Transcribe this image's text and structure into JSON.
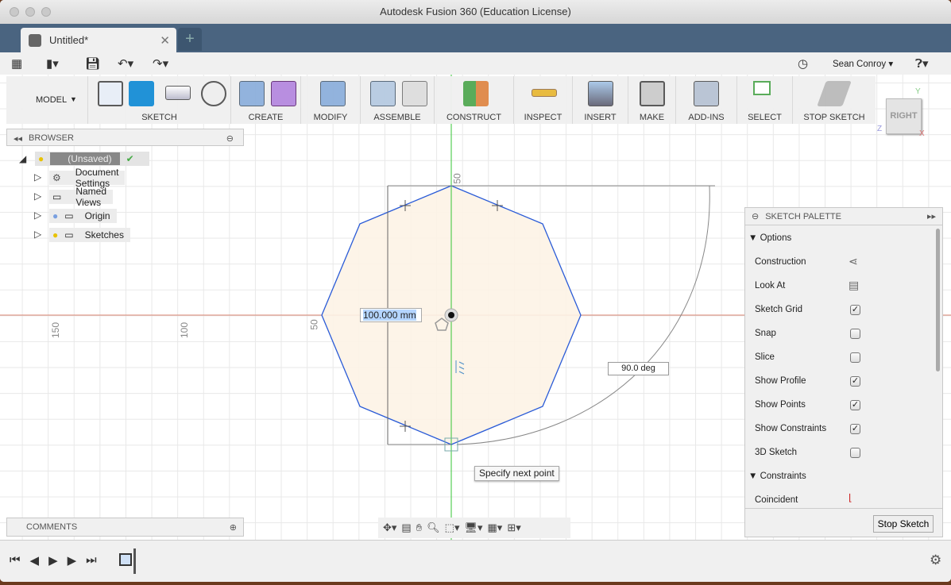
{
  "window": {
    "title": "Autodesk Fusion 360 (Education License)"
  },
  "tabs": [
    {
      "label": "Untitled*",
      "close": "✕"
    },
    {
      "label": "+"
    }
  ],
  "quickbar": {
    "user": "Sean Conroy"
  },
  "toolbar": {
    "workspace": "MODEL",
    "groups": [
      "SKETCH",
      "CREATE",
      "MODIFY",
      "ASSEMBLE",
      "CONSTRUCT",
      "INSPECT",
      "INSERT",
      "MAKE",
      "ADD-INS",
      "SELECT",
      "STOP SKETCH"
    ]
  },
  "viewcube": {
    "face": "RIGHT",
    "axes": {
      "y": "Y",
      "z": "Z",
      "x": "X"
    }
  },
  "browser": {
    "title": "BROWSER",
    "root": "(Unsaved)",
    "items": [
      "Document Settings",
      "Named Views",
      "Origin",
      "Sketches"
    ]
  },
  "comments": {
    "title": "COMMENTS"
  },
  "sketch_palette": {
    "title": "SKETCH PALETTE",
    "sections": {
      "options": "Options",
      "constraints": "Constraints"
    },
    "options": [
      {
        "label": "Construction",
        "type": "icon",
        "icon": "construction-icon"
      },
      {
        "label": "Look At",
        "type": "icon",
        "icon": "look-at-icon"
      },
      {
        "label": "Sketch Grid",
        "checked": true
      },
      {
        "label": "Snap",
        "checked": false
      },
      {
        "label": "Slice",
        "checked": false
      },
      {
        "label": "Show Profile",
        "checked": true
      },
      {
        "label": "Show Points",
        "checked": true
      },
      {
        "label": "Show Constraints",
        "checked": true
      },
      {
        "label": "3D Sketch",
        "checked": false
      }
    ],
    "constraints": [
      {
        "label": "Coincident",
        "icon": "coincident-icon"
      }
    ],
    "stop_button": "Stop Sketch"
  },
  "canvas": {
    "dimension_input": "100.000 mm",
    "angle": "90.0 deg",
    "tooltip": "Specify next point",
    "axis_labels": {
      "h150": "150",
      "h100": "100",
      "h50": "50",
      "v50": "50"
    },
    "colors": {
      "profile_fill": "#fdf3e6",
      "edges": "#2a5bd7",
      "x_axis": "#d9826e",
      "y_axis": "#35c435"
    }
  }
}
